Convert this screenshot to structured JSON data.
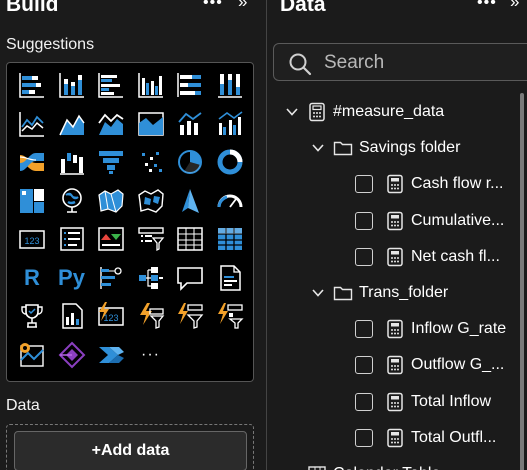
{
  "build": {
    "title": "Build",
    "suggestions_label": "Suggestions",
    "data_label": "Data",
    "add_data_button": "+Add data",
    "visuals": [
      {
        "name": "stacked-bar-chart-icon"
      },
      {
        "name": "stacked-column-chart-icon"
      },
      {
        "name": "clustered-bar-chart-icon"
      },
      {
        "name": "clustered-column-chart-icon"
      },
      {
        "name": "100-percent-stacked-bar-chart-icon"
      },
      {
        "name": "100-percent-stacked-column-chart-icon"
      },
      {
        "name": "line-chart-icon"
      },
      {
        "name": "area-chart-icon"
      },
      {
        "name": "stacked-area-chart-icon"
      },
      {
        "name": "100-percent-stacked-area-chart-icon"
      },
      {
        "name": "line-and-stacked-column-chart-icon"
      },
      {
        "name": "line-and-clustered-column-chart-icon"
      },
      {
        "name": "ribbon-chart-icon"
      },
      {
        "name": "waterfall-chart-icon"
      },
      {
        "name": "funnel-chart-icon"
      },
      {
        "name": "scatter-chart-icon"
      },
      {
        "name": "pie-chart-icon"
      },
      {
        "name": "donut-chart-icon"
      },
      {
        "name": "treemap-icon"
      },
      {
        "name": "map-globe-icon"
      },
      {
        "name": "filled-map-icon"
      },
      {
        "name": "shape-map-icon"
      },
      {
        "name": "azure-map-icon"
      },
      {
        "name": "gauge-icon"
      },
      {
        "name": "card-icon",
        "text": "123"
      },
      {
        "name": "multi-row-card-icon"
      },
      {
        "name": "kpi-icon"
      },
      {
        "name": "slicer-icon"
      },
      {
        "name": "table-icon"
      },
      {
        "name": "matrix-icon"
      },
      {
        "name": "r-script-visual-icon",
        "text": "R"
      },
      {
        "name": "python-visual-icon",
        "text": "Py"
      },
      {
        "name": "key-influencers-icon"
      },
      {
        "name": "decomposition-tree-icon"
      },
      {
        "name": "qa-icon"
      },
      {
        "name": "smart-narrative-icon"
      },
      {
        "name": "goals-icon"
      },
      {
        "name": "paginated-report-icon"
      },
      {
        "name": "card-new-icon",
        "text": "123"
      },
      {
        "name": "slicer-new-icon"
      },
      {
        "name": "filter-slicer-icon"
      },
      {
        "name": "button-slicer-icon"
      },
      {
        "name": "arcgis-map-icon"
      },
      {
        "name": "power-apps-icon"
      },
      {
        "name": "power-automate-icon"
      },
      {
        "name": "more-visuals-icon",
        "text": "···"
      }
    ]
  },
  "data_pane": {
    "title": "Data",
    "search_placeholder": "Search",
    "tree": [
      {
        "kind": "table",
        "label": "#measure_data",
        "level": 0,
        "checkbox": false,
        "icon": "measure-table"
      },
      {
        "kind": "folder",
        "label": "Savings folder",
        "level": 1,
        "checkbox": false,
        "icon": "folder"
      },
      {
        "kind": "measure",
        "label": "Cash flow r...",
        "level": 2,
        "checkbox": true,
        "icon": "calculator"
      },
      {
        "kind": "measure",
        "label": "Cumulative...",
        "level": 2,
        "checkbox": true,
        "icon": "calculator"
      },
      {
        "kind": "measure",
        "label": "Net cash fl...",
        "level": 2,
        "checkbox": true,
        "icon": "calculator"
      },
      {
        "kind": "folder",
        "label": "Trans_folder",
        "level": 1,
        "checkbox": false,
        "icon": "folder"
      },
      {
        "kind": "measure",
        "label": "Inflow G_rate",
        "level": 2,
        "checkbox": true,
        "icon": "calculator"
      },
      {
        "kind": "measure",
        "label": "Outflow G_...",
        "level": 2,
        "checkbox": true,
        "icon": "calculator"
      },
      {
        "kind": "measure",
        "label": "Total Inflow",
        "level": 2,
        "checkbox": true,
        "icon": "calculator"
      },
      {
        "kind": "measure",
        "label": "Total Outfl...",
        "level": 2,
        "checkbox": true,
        "icon": "calculator"
      },
      {
        "kind": "table",
        "label": "Calendar Table",
        "level": 0,
        "checkbox": false,
        "icon": "table"
      }
    ]
  },
  "colors": {
    "pane_bg": "#1b1b1b",
    "accent_blue": "#2f8fd8",
    "accent_orange": "#f2a12a",
    "accent_purple": "#8b3fc0"
  }
}
